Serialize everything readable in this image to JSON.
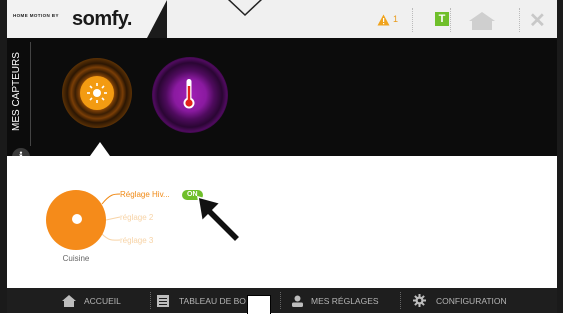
{
  "header": {
    "brand_tagline": "HOME MOTION BY",
    "brand_logo": "somfy.",
    "alert_count": "1",
    "t_label": "T",
    "icons": [
      "warning-icon",
      "t-badge-icon",
      "home-icon",
      "close-icon"
    ]
  },
  "sensors": {
    "section_label": "MES CAPTEURS",
    "items": [
      {
        "icon": "sun-icon",
        "color": "#f39b12",
        "selected": true
      },
      {
        "icon": "thermometer-icon",
        "color": "#a11fb5",
        "selected": false
      }
    ]
  },
  "room": {
    "name": "Cuisine",
    "color": "#f58b1a",
    "settings": [
      {
        "label": "Réglage Hiv...",
        "status": "ON",
        "active": true
      },
      {
        "label": "réglage 2",
        "active": false
      },
      {
        "label": "réglage 3",
        "active": false
      }
    ]
  },
  "nav": {
    "items": [
      {
        "label": "ACCUEIL",
        "icon": "home-icon"
      },
      {
        "label": "TABLEAU DE BO",
        "icon": "dashboard-icon"
      },
      {
        "label": "MES RÉGLAGES",
        "icon": "user-icon"
      },
      {
        "label": "CONFIGURATION",
        "icon": "gear-icon"
      }
    ]
  },
  "colors": {
    "accent_orange": "#f58b1a",
    "accent_green": "#6fbf2a",
    "accent_purple": "#a11fb5",
    "dark_bg": "#0c0c0c"
  }
}
